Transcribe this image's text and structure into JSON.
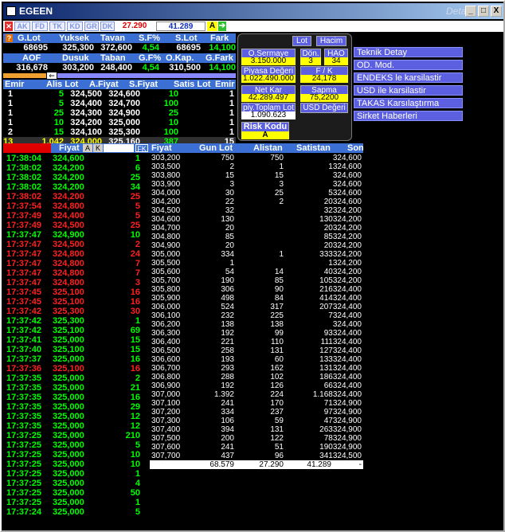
{
  "window": {
    "title": "EGEEN",
    "detail": "Detay",
    "min": "_",
    "max": "□",
    "close": "X"
  },
  "toolbar": {
    "buttons": [
      "AK",
      "FD",
      "TK",
      "KD",
      "GR",
      "DK"
    ],
    "price_red": "27.290",
    "price_blue": "41.289",
    "a_label": "A"
  },
  "summary": {
    "headers1": [
      "G.Lot",
      "Yuksek",
      "Tavan",
      "S.F%",
      "S.Lot",
      "Fark"
    ],
    "values1": [
      "68695",
      "325,300",
      "372,600",
      "4,54",
      "68695",
      "14,100"
    ],
    "headers2": [
      "AOF",
      "Dusuk",
      "Taban",
      "G.F%",
      "O.Kap.",
      "G.Fark"
    ],
    "values2": [
      "316,678",
      "303,200",
      "248,400",
      "4,54",
      "310,500",
      "14,100"
    ]
  },
  "orders": {
    "headers": [
      "Emir",
      "Alis Lot",
      "A.Fiyat",
      "S.Fiyat",
      "Satis Lot",
      "Emir"
    ],
    "rows": [
      [
        "1",
        "5",
        "324,500",
        "324,600",
        "10",
        "1"
      ],
      [
        "1",
        "5",
        "324,400",
        "324,700",
        "100",
        "1"
      ],
      [
        "1",
        "25",
        "324,300",
        "324,900",
        "25",
        "1"
      ],
      [
        "1",
        "10",
        "324,200",
        "325,000",
        "10",
        "1"
      ],
      [
        "2",
        "15",
        "324,100",
        "325,300",
        "100",
        "1"
      ],
      [
        "13",
        "1.042",
        "324,000",
        "325,160",
        "387",
        "15"
      ]
    ]
  },
  "panel": {
    "lot_btn": "Lot",
    "hacim_btn": "Hacim",
    "o_sermaye_l": "O.Sermaye",
    "o_sermaye_v": "3.150.000",
    "don_l": "Dön.",
    "don_v": "3",
    "hao_l": "HAO",
    "hao_v": "34",
    "piyasa_l": "Piyasa Değeri",
    "piyasa_v": "1.022.490.000",
    "fk_l": "F / K",
    "fk_v": "24,178",
    "netkar_l": "Net Kar",
    "netkar_v": "42.289.497",
    "sapma_l": "Sapma",
    "sapma_v": "75,2200",
    "toplam_l": "piy.Toplam Lot",
    "toplam_v": "1.090.623",
    "usd_btn": "USD Değeri",
    "risk_l": "Risk Kodu",
    "risk_v": "A"
  },
  "menu": [
    "Teknik Detay",
    "OD. Mod.",
    "ENDEKS le karsilastir",
    "USD ile karsilastir",
    "TAKAS Karsılaştırma",
    "Sirket Haberleri"
  ],
  "trades": {
    "header_fiyat": "Fiyat",
    "btn_a": "A",
    "btn_k": "K",
    "btn_fk": "FK",
    "rows": [
      [
        "17:38:04",
        "324,600",
        "1",
        "g"
      ],
      [
        "17:38:02",
        "324,200",
        "6",
        "g"
      ],
      [
        "17:38:02",
        "324,200",
        "25",
        "g"
      ],
      [
        "17:38:02",
        "324,200",
        "34",
        "g"
      ],
      [
        "17:38:02",
        "324,200",
        "25",
        "r"
      ],
      [
        "17:37:54",
        "324,800",
        "5",
        "r"
      ],
      [
        "17:37:49",
        "324,400",
        "5",
        "r"
      ],
      [
        "17:37:49",
        "324,500",
        "25",
        "r"
      ],
      [
        "17:37:47",
        "324,900",
        "10",
        "g"
      ],
      [
        "17:37:47",
        "324,500",
        "2",
        "r"
      ],
      [
        "17:37:47",
        "324,800",
        "24",
        "r"
      ],
      [
        "17:37:47",
        "324,800",
        "7",
        "r"
      ],
      [
        "17:37:47",
        "324,800",
        "7",
        "r"
      ],
      [
        "17:37:47",
        "324,800",
        "3",
        "r"
      ],
      [
        "17:37:45",
        "325,100",
        "16",
        "r"
      ],
      [
        "17:37:45",
        "325,100",
        "16",
        "r"
      ],
      [
        "17:37:42",
        "325,300",
        "30",
        "r"
      ],
      [
        "17:37:42",
        "325,300",
        "1",
        "g"
      ],
      [
        "17:37:42",
        "325,100",
        "69",
        "g"
      ],
      [
        "17:37:41",
        "325,000",
        "15",
        "g"
      ],
      [
        "17:37:40",
        "325,100",
        "15",
        "g"
      ],
      [
        "17:37:37",
        "325,000",
        "16",
        "g"
      ],
      [
        "17:37:36",
        "325,100",
        "16",
        "r"
      ],
      [
        "17:37:35",
        "325,000",
        "2",
        "g"
      ],
      [
        "17:37:35",
        "325,000",
        "21",
        "g"
      ],
      [
        "17:37:35",
        "325,000",
        "16",
        "g"
      ],
      [
        "17:37:35",
        "325,000",
        "29",
        "g"
      ],
      [
        "17:37:35",
        "325,000",
        "12",
        "g"
      ],
      [
        "17:37:35",
        "325,000",
        "12",
        "g"
      ],
      [
        "17:37:25",
        "325,000",
        "210",
        "g"
      ],
      [
        "17:37:25",
        "325,000",
        "5",
        "g"
      ],
      [
        "17:37:25",
        "325,000",
        "10",
        "g"
      ],
      [
        "17:37:25",
        "325,000",
        "10",
        "g"
      ],
      [
        "17:37:25",
        "325,000",
        "1",
        "g"
      ],
      [
        "17:37:25",
        "325,000",
        "4",
        "g"
      ],
      [
        "17:37:25",
        "325,000",
        "50",
        "g"
      ],
      [
        "17:37:25",
        "325,000",
        "1",
        "g"
      ],
      [
        "17:37:24",
        "325,000",
        "5",
        "g"
      ]
    ]
  },
  "depth": {
    "headers": [
      "Fiyat",
      "Gun Lot",
      "Alistan",
      "Satistan",
      "Son"
    ],
    "rows": [
      [
        "303,200",
        "750",
        "750",
        "324,600"
      ],
      [
        "303,500",
        "2",
        "1",
        "1324,600"
      ],
      [
        "303,800",
        "15",
        "15",
        "324,600"
      ],
      [
        "303,900",
        "3",
        "3",
        "324,600"
      ],
      [
        "304,000",
        "30",
        "25",
        "5324,600"
      ],
      [
        "304,200",
        "22",
        "2",
        "20324,600"
      ],
      [
        "304,500",
        "32",
        "",
        "32324,200"
      ],
      [
        "304,600",
        "130",
        "",
        "130324,200"
      ],
      [
        "304,700",
        "20",
        "",
        "20324,200"
      ],
      [
        "304,800",
        "85",
        "",
        "85324,200"
      ],
      [
        "304,900",
        "20",
        "",
        "20324,200"
      ],
      [
        "305,000",
        "334",
        "1",
        "333324,200"
      ],
      [
        "305,500",
        "1",
        "",
        "1324,200"
      ],
      [
        "305,600",
        "54",
        "14",
        "40324,200"
      ],
      [
        "305,700",
        "190",
        "85",
        "105324,200"
      ],
      [
        "305,800",
        "306",
        "90",
        "216324,400"
      ],
      [
        "305,900",
        "498",
        "84",
        "414324,400"
      ],
      [
        "306,000",
        "524",
        "317",
        "207324,400"
      ],
      [
        "306,100",
        "232",
        "225",
        "7324,400"
      ],
      [
        "306,200",
        "138",
        "138",
        "324,400"
      ],
      [
        "306,300",
        "192",
        "99",
        "93324,400"
      ],
      [
        "306,400",
        "221",
        "110",
        "111324,400"
      ],
      [
        "306,500",
        "258",
        "131",
        "127324,400"
      ],
      [
        "306,600",
        "193",
        "60",
        "133324,400"
      ],
      [
        "306,700",
        "293",
        "162",
        "131324,400"
      ],
      [
        "306,800",
        "288",
        "102",
        "186324,400"
      ],
      [
        "306,900",
        "192",
        "126",
        "66324,400"
      ],
      [
        "307,000",
        "1.392",
        "224",
        "1.168324,400"
      ],
      [
        "307,100",
        "241",
        "170",
        "71324,900"
      ],
      [
        "307,200",
        "334",
        "237",
        "97324,900"
      ],
      [
        "307,300",
        "106",
        "59",
        "47324,900"
      ],
      [
        "307,400",
        "394",
        "131",
        "263324,900"
      ],
      [
        "307,500",
        "200",
        "122",
        "78324,900"
      ],
      [
        "307,600",
        "241",
        "51",
        "190324,900"
      ],
      [
        "307,700",
        "437",
        "96",
        "341324,500"
      ]
    ],
    "totals": [
      "68.579",
      "27.290",
      "41.289",
      "-"
    ]
  }
}
